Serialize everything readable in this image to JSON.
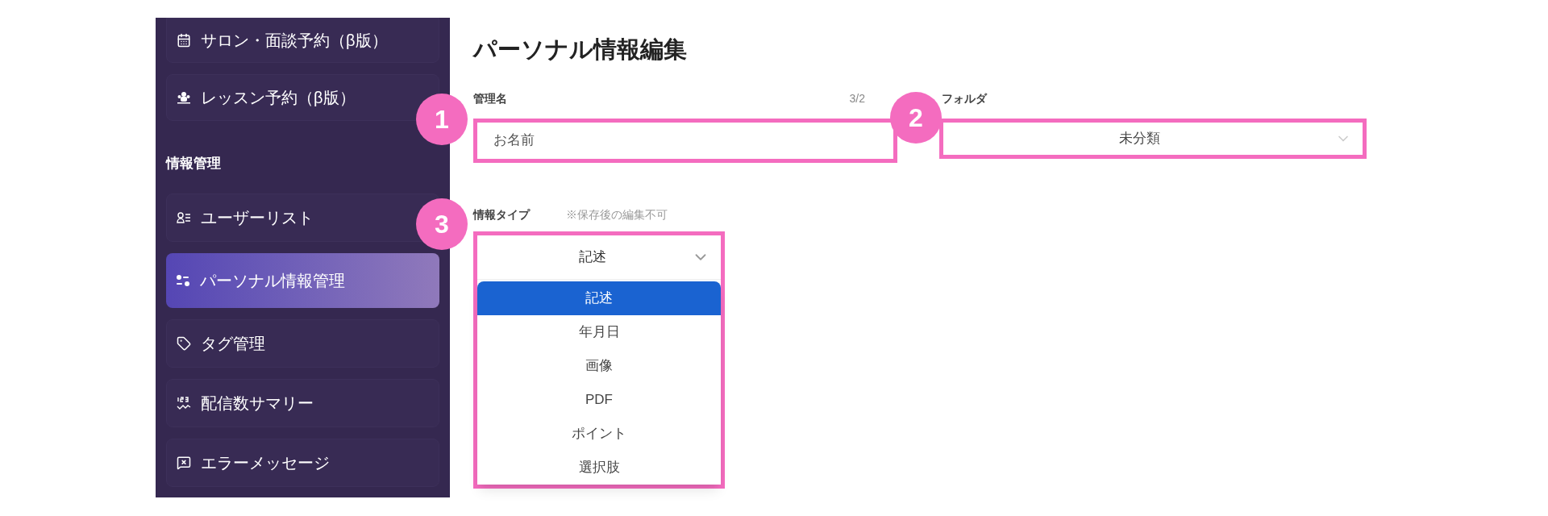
{
  "sidebar": {
    "items": [
      {
        "label": "サロン・面談予約（β版）",
        "kind": "calendar",
        "selected": false
      },
      {
        "label": "レッスン予約（β版）",
        "kind": "lesson",
        "selected": false
      }
    ],
    "section": {
      "title": "情報管理",
      "items": [
        {
          "label": "ユーザーリスト",
          "kind": "userlist",
          "selected": false
        },
        {
          "label": "パーソナル情報管理",
          "kind": "personal",
          "selected": true
        },
        {
          "label": "タグ管理",
          "kind": "tag",
          "selected": false
        },
        {
          "label": "配信数サマリー",
          "kind": "summary",
          "selected": false
        },
        {
          "label": "エラーメッセージ",
          "kind": "error",
          "selected": false
        }
      ]
    }
  },
  "page": {
    "title": "パーソナル情報編集",
    "name_field": {
      "label": "管理名",
      "counter": "3/2",
      "value": "お名前"
    },
    "folder_field": {
      "label": "フォルダ",
      "value": "未分類"
    },
    "type_field": {
      "label": "情報タイプ",
      "note": "※保存後の編集不可",
      "value": "記述",
      "expanded": true,
      "options": [
        {
          "label": "記述",
          "selected": true
        },
        {
          "label": "年月日",
          "selected": false
        },
        {
          "label": "画像",
          "selected": false
        },
        {
          "label": "PDF",
          "selected": false
        },
        {
          "label": "ポイント",
          "selected": false
        },
        {
          "label": "選択肢",
          "selected": false
        }
      ]
    }
  },
  "annotations": [
    {
      "number": "1"
    },
    {
      "number": "2"
    },
    {
      "number": "3"
    }
  ]
}
